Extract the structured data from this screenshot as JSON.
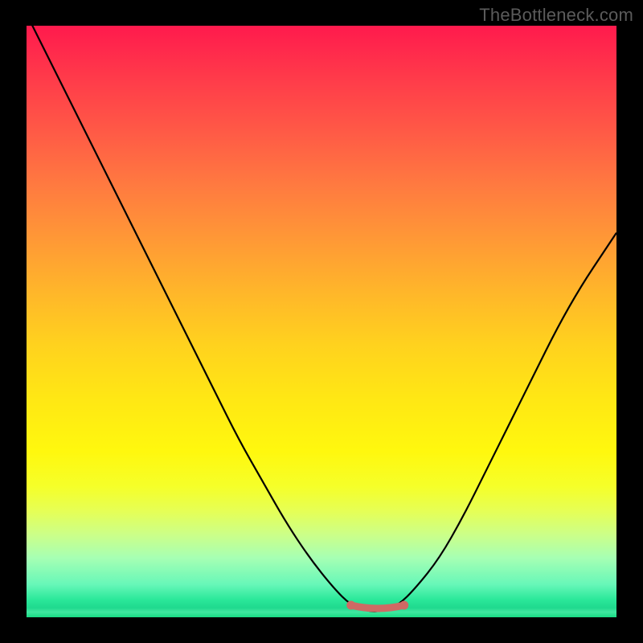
{
  "watermark": "TheBottleneck.com",
  "colors": {
    "frame": "#000000",
    "curve": "#000000",
    "highlight": "#cf6a64",
    "gradient_top": "#ff1a4d",
    "gradient_bottom": "#18db84"
  },
  "chart_data": {
    "type": "line",
    "title": "",
    "xlabel": "",
    "ylabel": "",
    "xlim": [
      0,
      100
    ],
    "ylim": [
      0,
      100
    ],
    "x": [
      0,
      4,
      8,
      12,
      16,
      20,
      24,
      28,
      32,
      36,
      40,
      44,
      48,
      52,
      55,
      58,
      60,
      63,
      66,
      70,
      74,
      78,
      82,
      86,
      90,
      94,
      98,
      100
    ],
    "values": [
      102,
      94,
      86,
      78,
      70,
      62,
      54,
      46,
      38,
      30,
      23,
      16,
      10,
      5,
      2,
      1,
      1,
      2,
      5,
      10,
      17,
      25,
      33,
      41,
      49,
      56,
      62,
      65
    ],
    "highlight_band": {
      "x_start": 55,
      "x_end": 64,
      "y": 1.5
    }
  }
}
